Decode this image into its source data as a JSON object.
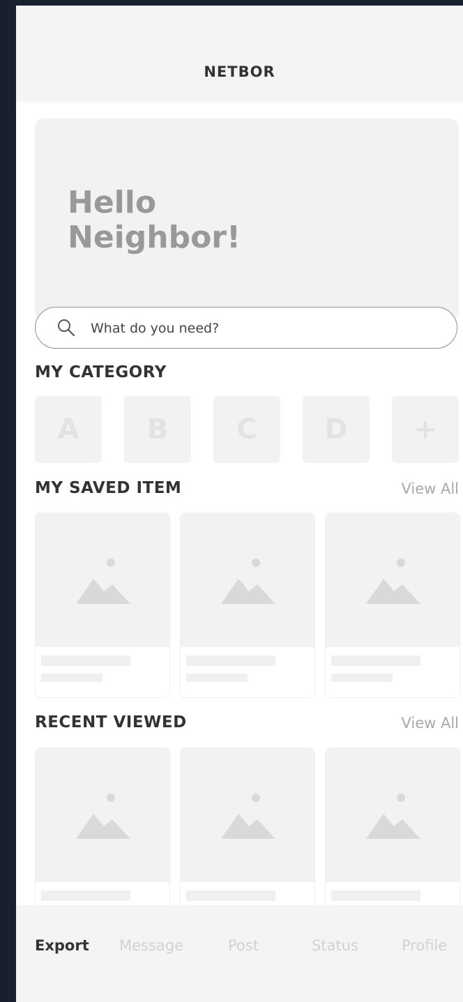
{
  "app": {
    "title": "NETBOR"
  },
  "hero": {
    "greeting_line1": "Hello",
    "greeting_line2": "Neighbor!"
  },
  "search": {
    "placeholder": "What do you need?",
    "icon": "search-icon"
  },
  "category": {
    "title": "MY CATEGORY",
    "tiles": [
      "A",
      "B",
      "C",
      "D",
      "+"
    ]
  },
  "saved": {
    "title": "MY SAVED ITEM",
    "view_all": "View All",
    "card_count": 3
  },
  "recent": {
    "title": "RECENT VIEWED",
    "view_all": "View All",
    "card_count": 3
  },
  "tabs": [
    {
      "label": "Export",
      "active": true
    },
    {
      "label": "Message",
      "active": false
    },
    {
      "label": "Post",
      "active": false
    },
    {
      "label": "Status",
      "active": false
    },
    {
      "label": "Profile",
      "active": false
    }
  ],
  "colors": {
    "background": "#18202e",
    "bar": "#f4f4f4",
    "placeholder": "#f2f2f2",
    "text_dark": "#333333",
    "text_muted": "#a8a8a8"
  }
}
